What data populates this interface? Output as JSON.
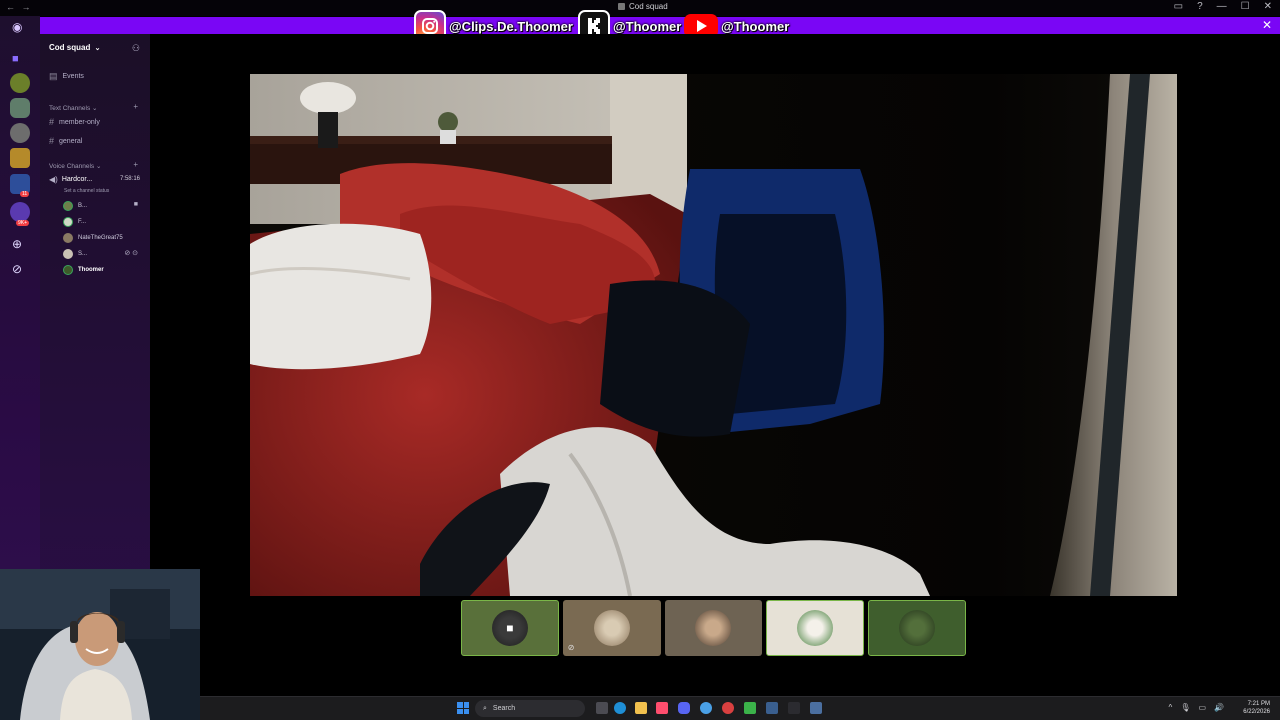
{
  "window": {
    "title": "Cod squad",
    "nav_arrows": "← →",
    "controls": [
      "▭",
      "?",
      "—",
      "☐",
      "✕"
    ]
  },
  "banner": {
    "close": "✕",
    "socials": [
      {
        "platform": "instagram",
        "icon": "instagram-icon",
        "handle": "@Clips.De.Thoomer"
      },
      {
        "platform": "kick",
        "icon": "kick-icon",
        "handle": "@Thoomer"
      },
      {
        "platform": "youtube",
        "icon": "youtube-icon",
        "handle": "@Thoomer"
      }
    ]
  },
  "sidebar": {
    "server_name": "Cod squad",
    "server_chevron": "⌄",
    "invite_icon": "add-person-icon",
    "events_label": "Events",
    "text_category": "Text Channels",
    "text_channels": [
      "member-only",
      "general"
    ],
    "voice_category": "Voice Channels",
    "voice_channel": {
      "name": "Hardcor...",
      "timer": "7:58:16",
      "status_hint": "Set a channel status"
    },
    "members": [
      "B...",
      "F...",
      "NateTheGreat75",
      "S...",
      "Thoomer"
    ],
    "badges": {
      "notif_1": "11",
      "notif_2": "9K+"
    }
  },
  "taskbar": {
    "search_label": "Search",
    "time": "7:21 PM",
    "date": "6/22/2026",
    "tray": [
      "^",
      "🎙",
      "▭",
      "🔊"
    ]
  },
  "colors": {
    "banner": "#7a06f5",
    "sidebar": "#2b0d48",
    "speaking_border": "#3ba55c"
  }
}
